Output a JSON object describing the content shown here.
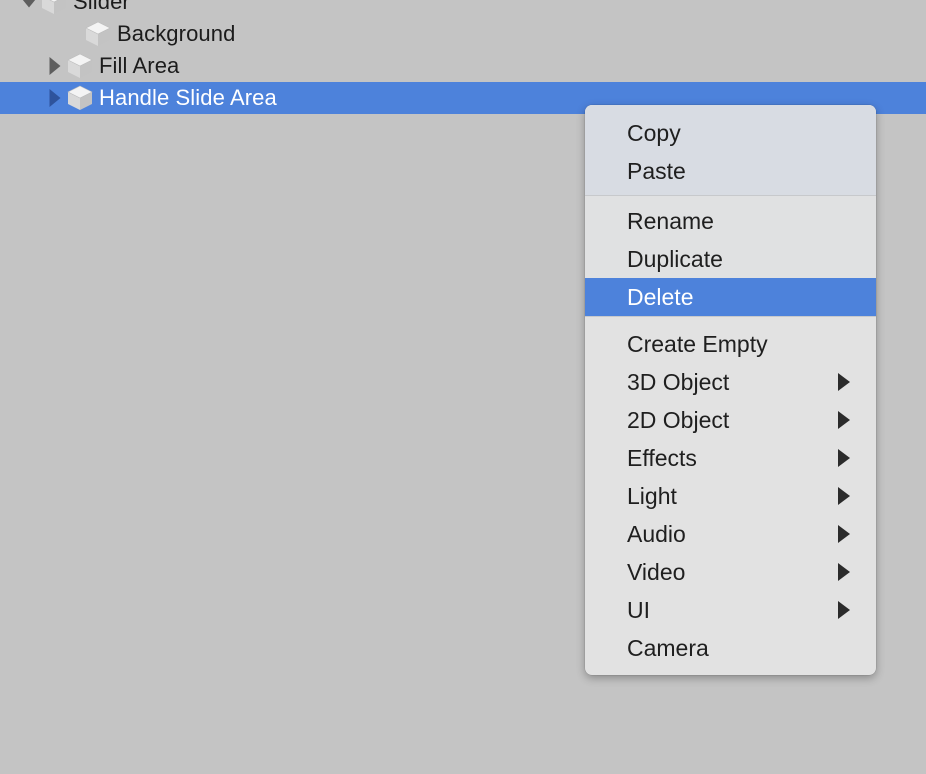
{
  "hierarchy": {
    "rows": [
      {
        "label": "Slider",
        "indent": 18,
        "twisty": "down",
        "icon": "gameobject-cube-icon",
        "selected": false
      },
      {
        "label": "Background",
        "indent": 62,
        "twisty": "none",
        "icon": "gameobject-cube-icon",
        "selected": false
      },
      {
        "label": "Fill Area",
        "indent": 44,
        "twisty": "right",
        "icon": "gameobject-cube-icon",
        "selected": false
      },
      {
        "label": "Handle Slide Area",
        "indent": 44,
        "twisty": "right",
        "icon": "gameobject-cube-icon",
        "selected": true
      }
    ]
  },
  "context_menu": {
    "sections": [
      {
        "name": "clipboard",
        "items": [
          {
            "label": "Copy",
            "submenu": false,
            "highlighted": false
          },
          {
            "label": "Paste",
            "submenu": false,
            "highlighted": false
          }
        ]
      },
      {
        "name": "edit",
        "items": [
          {
            "label": "Rename",
            "submenu": false,
            "highlighted": false
          },
          {
            "label": "Duplicate",
            "submenu": false,
            "highlighted": false
          },
          {
            "label": "Delete",
            "submenu": false,
            "highlighted": true
          }
        ]
      },
      {
        "name": "create",
        "items": [
          {
            "label": "Create Empty",
            "submenu": false,
            "highlighted": false
          },
          {
            "label": "3D Object",
            "submenu": true,
            "highlighted": false
          },
          {
            "label": "2D Object",
            "submenu": true,
            "highlighted": false
          },
          {
            "label": "Effects",
            "submenu": true,
            "highlighted": false
          },
          {
            "label": "Light",
            "submenu": true,
            "highlighted": false
          },
          {
            "label": "Audio",
            "submenu": true,
            "highlighted": false
          },
          {
            "label": "Video",
            "submenu": true,
            "highlighted": false
          },
          {
            "label": "UI",
            "submenu": true,
            "highlighted": false
          },
          {
            "label": "Camera",
            "submenu": false,
            "highlighted": false
          }
        ]
      }
    ]
  },
  "colors": {
    "selection_blue": "#4d82db",
    "panel_background": "#c4c4c4",
    "menu_background": "#e2e2e2",
    "menu_top_section": "#d8dce3",
    "text": "#1f1f1f",
    "selected_text": "#ffffff"
  }
}
